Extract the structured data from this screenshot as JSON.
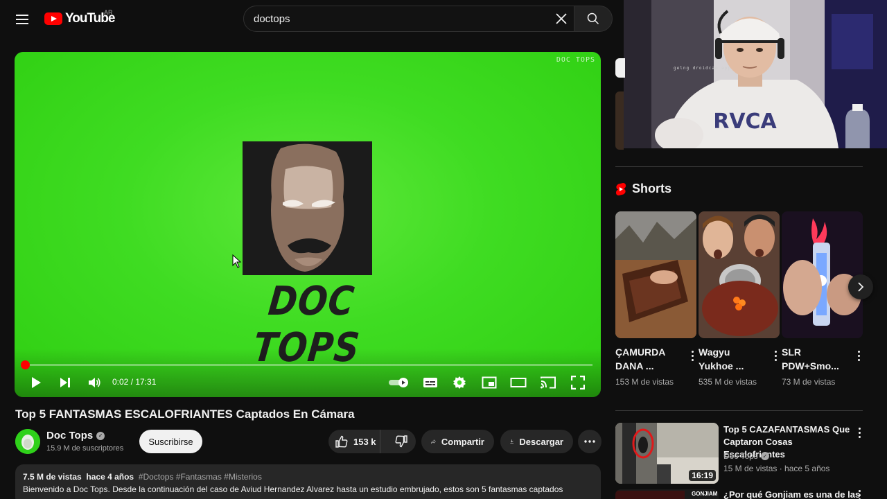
{
  "header": {
    "logo_text": "YouTube",
    "country_code": "AR",
    "search_value": "doctops"
  },
  "player": {
    "watermark": "DOC TOPS",
    "brand_text": "DOC TOPS",
    "current_time": "0:02",
    "duration": "17:31",
    "time_display": "0:02 / 17:31",
    "progress_fraction": 0.0019
  },
  "video": {
    "title": "Top 5 FANTASMAS ESCALOFRIANTES Captados En Cámara",
    "channel_name": "Doc Tops",
    "subscribers": "15.9 M de suscriptores",
    "subscribe_label": "Suscribirse",
    "likes": "153 k",
    "share_label": "Compartir",
    "download_label": "Descargar"
  },
  "description": {
    "views": "7.5 M de vistas",
    "age": "hace 4 años",
    "tags": "#Doctops #Fantasmas #Misterios",
    "text": "Bienvenido a Doc Tops.  Desde la continuación del caso de Aviud Hernandez Alvarez hasta un estudio embrujado, estos son 5 fantasmas captados"
  },
  "webcam": {
    "label": "gelng droidcam app"
  },
  "shorts": {
    "heading": "Shorts",
    "items": [
      {
        "title": "ÇAMURDA DANA ...",
        "views": "153 M de vistas"
      },
      {
        "title": "Wagyu Yukhoe ...",
        "views": "535 M de vistas"
      },
      {
        "title": "SLR PDW+Smo...",
        "views": "73 M de vistas"
      }
    ]
  },
  "recommendations": [
    {
      "title": "Top 5 CAZAFANTASMAS Que Captaron Cosas Escalofriantes",
      "channel": "Doc Tops",
      "meta": "15 M de vistas · hace 5 años",
      "duration": "16:19"
    },
    {
      "title": "¿Por qué Gonjiam es una de las",
      "thumb_label": "GONJIAM"
    }
  ],
  "colors": {
    "background": "#0f0f0f",
    "accent_red": "#ff0000",
    "green_screen": "#3fdc22",
    "pill_bg": "#272727"
  }
}
